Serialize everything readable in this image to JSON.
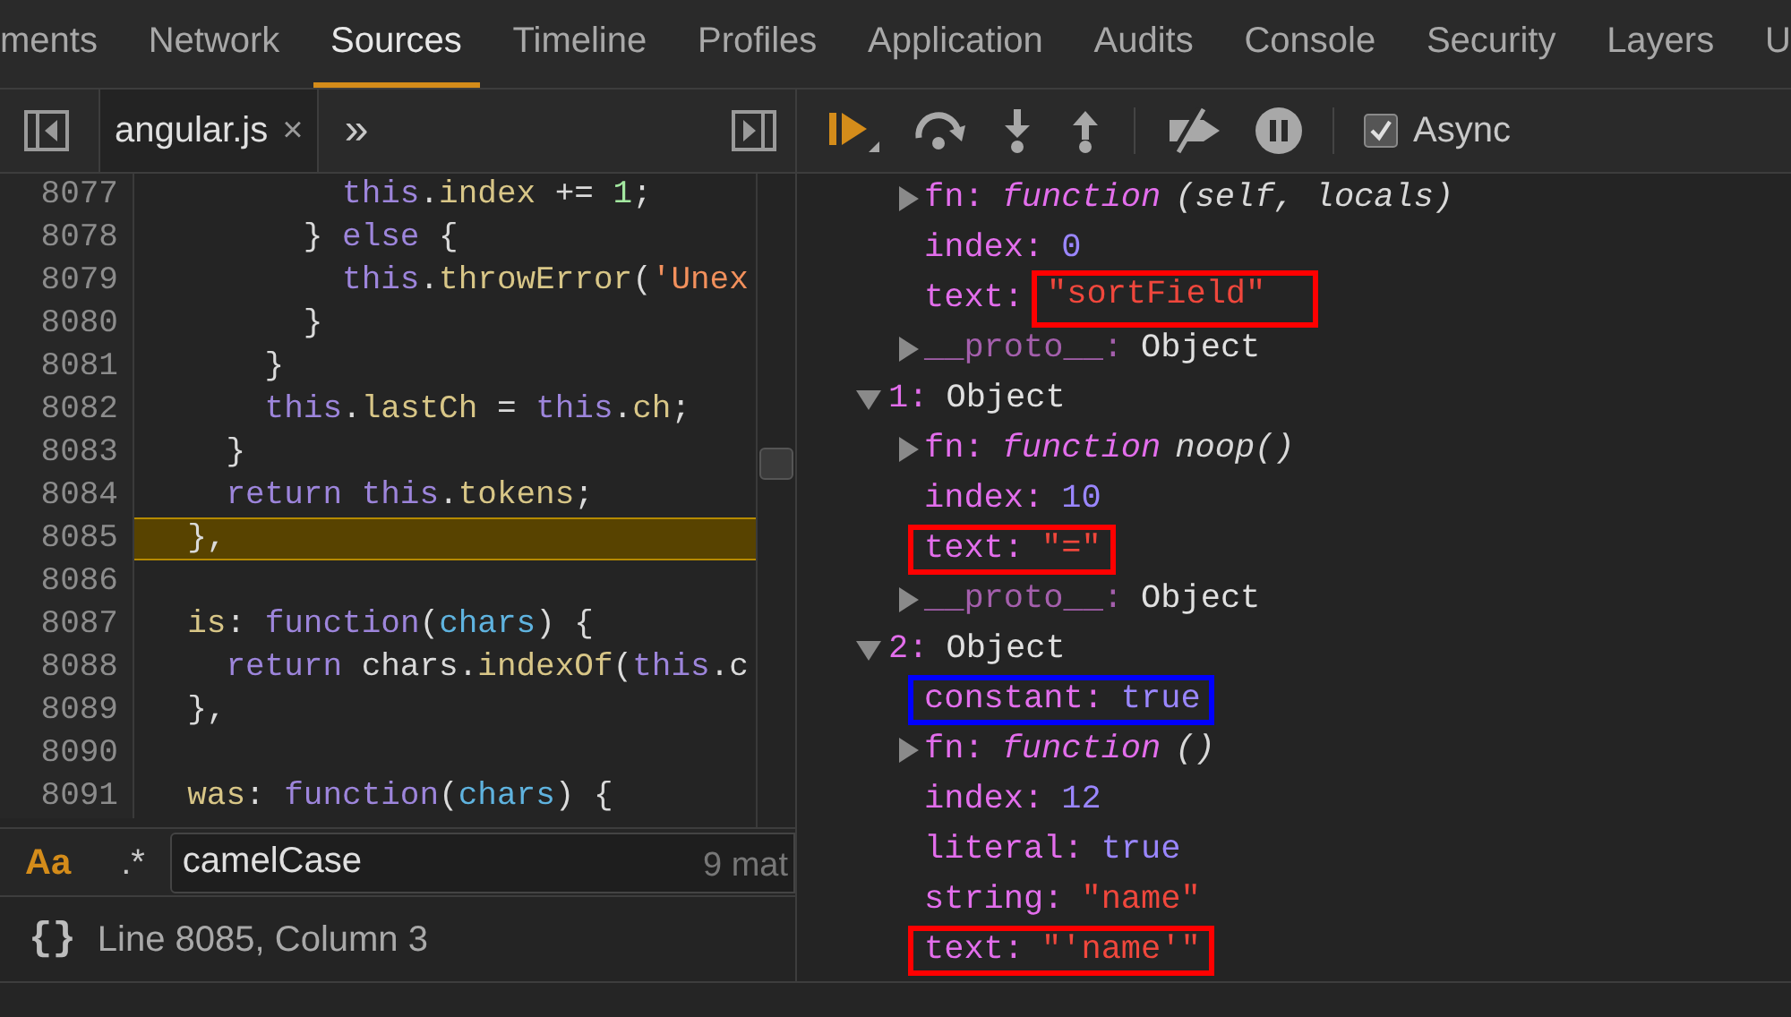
{
  "main_tabs": [
    {
      "label": "ments",
      "selected": false
    },
    {
      "label": "Network",
      "selected": false
    },
    {
      "label": "Sources",
      "selected": true
    },
    {
      "label": "Timeline",
      "selected": false
    },
    {
      "label": "Profiles",
      "selected": false
    },
    {
      "label": "Application",
      "selected": false
    },
    {
      "label": "Audits",
      "selected": false
    },
    {
      "label": "Console",
      "selected": false
    },
    {
      "label": "Security",
      "selected": false
    },
    {
      "label": "Layers",
      "selected": false
    },
    {
      "label": "U",
      "selected": false
    }
  ],
  "editor": {
    "file_tabs": [
      {
        "label": "angular.js",
        "close": "×"
      }
    ],
    "more": "»",
    "lines": [
      {
        "number": "8077",
        "current": false,
        "tokens": [
          {
            "kind": "keyword",
            "text": "          this"
          },
          {
            "kind": "plain",
            "text": "."
          },
          {
            "kind": "prop",
            "text": "index"
          },
          {
            "kind": "plain",
            "text": " += "
          },
          {
            "kind": "number",
            "text": "1"
          },
          {
            "kind": "plain",
            "text": ";"
          }
        ]
      },
      {
        "number": "8078",
        "current": false,
        "tokens": [
          {
            "kind": "plain",
            "text": "        } "
          },
          {
            "kind": "keyword",
            "text": "else"
          },
          {
            "kind": "plain",
            "text": " {"
          }
        ]
      },
      {
        "number": "8079",
        "current": false,
        "tokens": [
          {
            "kind": "keyword",
            "text": "          this"
          },
          {
            "kind": "plain",
            "text": "."
          },
          {
            "kind": "prop",
            "text": "throwError"
          },
          {
            "kind": "plain",
            "text": "("
          },
          {
            "kind": "string",
            "text": "'Unex"
          }
        ]
      },
      {
        "number": "8080",
        "current": false,
        "tokens": [
          {
            "kind": "plain",
            "text": "        }"
          }
        ]
      },
      {
        "number": "8081",
        "current": false,
        "tokens": [
          {
            "kind": "plain",
            "text": "      }"
          }
        ]
      },
      {
        "number": "8082",
        "current": false,
        "tokens": [
          {
            "kind": "keyword",
            "text": "      this"
          },
          {
            "kind": "plain",
            "text": "."
          },
          {
            "kind": "prop",
            "text": "lastCh"
          },
          {
            "kind": "plain",
            "text": " = "
          },
          {
            "kind": "keyword",
            "text": "this"
          },
          {
            "kind": "plain",
            "text": "."
          },
          {
            "kind": "prop",
            "text": "ch"
          },
          {
            "kind": "plain",
            "text": ";"
          }
        ]
      },
      {
        "number": "8083",
        "current": false,
        "tokens": [
          {
            "kind": "plain",
            "text": "    }"
          }
        ]
      },
      {
        "number": "8084",
        "current": false,
        "tokens": [
          {
            "kind": "keyword",
            "text": "    return this"
          },
          {
            "kind": "plain",
            "text": "."
          },
          {
            "kind": "prop",
            "text": "tokens"
          },
          {
            "kind": "plain",
            "text": ";"
          }
        ]
      },
      {
        "number": "8085",
        "current": true,
        "tokens": [
          {
            "kind": "plain",
            "text": "  },"
          }
        ]
      },
      {
        "number": "8086",
        "current": false
      },
      {
        "number": "8087",
        "current": false,
        "tokens": [
          {
            "kind": "prop",
            "text": "  is"
          },
          {
            "kind": "plain",
            "text": ": "
          },
          {
            "kind": "keyword",
            "text": "function"
          },
          {
            "kind": "plain",
            "text": "("
          },
          {
            "kind": "param",
            "text": "chars"
          },
          {
            "kind": "plain",
            "text": ") {"
          }
        ]
      },
      {
        "number": "8088",
        "current": false,
        "tokens": [
          {
            "kind": "keyword",
            "text": "    return"
          },
          {
            "kind": "plain",
            "text": " chars."
          },
          {
            "kind": "prop",
            "text": "indexOf"
          },
          {
            "kind": "plain",
            "text": "("
          },
          {
            "kind": "keyword",
            "text": "this"
          },
          {
            "kind": "plain",
            "text": ".c"
          }
        ]
      },
      {
        "number": "8089",
        "current": false,
        "tokens": [
          {
            "kind": "plain",
            "text": "  },"
          }
        ]
      },
      {
        "number": "8090",
        "current": false
      },
      {
        "number": "8091",
        "current": false,
        "tokens": [
          {
            "kind": "prop",
            "text": "  was"
          },
          {
            "kind": "plain",
            "text": ": "
          },
          {
            "kind": "keyword",
            "text": "function"
          },
          {
            "kind": "plain",
            "text": "("
          },
          {
            "kind": "param",
            "text": "chars"
          },
          {
            "kind": "plain",
            "text": ") {"
          }
        ]
      }
    ],
    "search": {
      "toggles": [
        {
          "label": "Aa",
          "selected": true
        },
        {
          "label": ".*",
          "selected": false
        }
      ],
      "value": "camelCase",
      "matches": "9 mat"
    },
    "status": {
      "pretty_print": "{}",
      "position": "Line 8085, Column 3"
    }
  },
  "debugger": {
    "async": {
      "label": "Async",
      "checked": true
    },
    "scope_tree": {
      "separator": ":",
      "properties": [
        {
          "name": "fn",
          "value": "function",
          "kind": "function",
          "signature": "(self, locals)",
          "expandable": true,
          "dimmed": false
        },
        {
          "name": "index",
          "value": "0",
          "kind": "number",
          "expandable": false,
          "dimmed": false
        },
        {
          "name": "text",
          "value": "\"sortField\"",
          "kind": "string",
          "expandable": false,
          "dimmed": false,
          "box": {
            "color": "#ff0000",
            "value_only": true
          }
        },
        {
          "name": "__proto__",
          "value": "Object",
          "kind": "object",
          "expandable": true,
          "dimmed": true
        }
      ],
      "objects": [
        {
          "key": "1",
          "value": "Object",
          "expanded": true,
          "properties": [
            {
              "name": "fn",
              "value": "function",
              "kind": "function",
              "signature": "noop()",
              "expandable": true,
              "dimmed": false
            },
            {
              "name": "index",
              "value": "10",
              "kind": "number",
              "expandable": false,
              "dimmed": false
            },
            {
              "name": "text",
              "value": "\"=\"",
              "kind": "string",
              "expandable": false,
              "dimmed": false,
              "box": {
                "color": "#ff0000",
                "value_only": false
              }
            },
            {
              "name": "__proto__",
              "value": "Object",
              "kind": "object",
              "expandable": true,
              "dimmed": true
            }
          ]
        },
        {
          "key": "2",
          "value": "Object",
          "expanded": true,
          "properties": [
            {
              "name": "constant",
              "value": "true",
              "kind": "boolean",
              "expandable": false,
              "dimmed": false,
              "box": {
                "color": "#0000ff",
                "value_only": false
              }
            },
            {
              "name": "fn",
              "value": "function",
              "kind": "function",
              "signature": "()",
              "expandable": true,
              "dimmed": false
            },
            {
              "name": "index",
              "value": "12",
              "kind": "number",
              "expandable": false,
              "dimmed": false
            },
            {
              "name": "literal",
              "value": "true",
              "kind": "boolean",
              "expandable": false,
              "dimmed": false
            },
            {
              "name": "string",
              "value": "\"name\"",
              "kind": "string",
              "expandable": false,
              "dimmed": false
            },
            {
              "name": "text",
              "value": "\"'name'\"",
              "kind": "string",
              "expandable": false,
              "dimmed": false,
              "box": {
                "color": "#ff0000",
                "value_only": false
              }
            }
          ]
        }
      ]
    }
  }
}
